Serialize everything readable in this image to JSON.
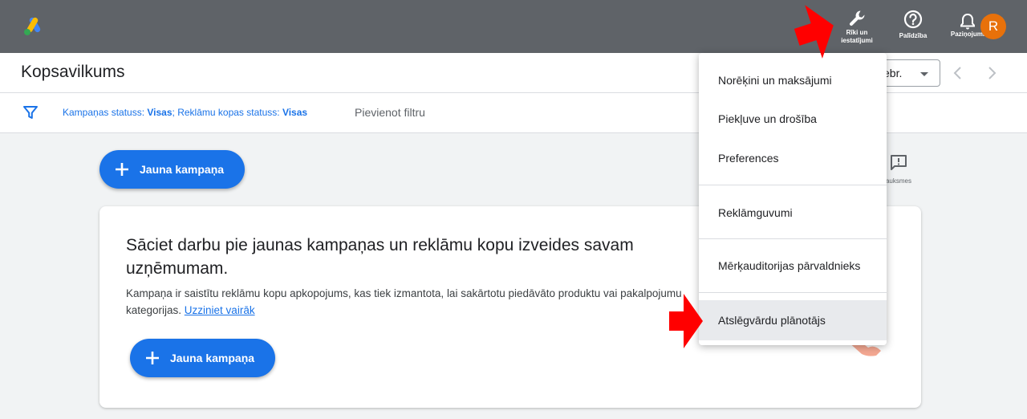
{
  "topbar": {
    "tools_label_line1": "Rīki un",
    "tools_label_line2": "iestatījumi",
    "help_label": "Palīdzība",
    "notifications_label": "Paziņojumi",
    "avatar_initial": "R",
    "bg_color": "#5f6368",
    "avatar_color": "#e8710a"
  },
  "header": {
    "page_title": "Kopsavilkums",
    "date_range_value": "ebr."
  },
  "filter_bar": {
    "campaign_status_label": "Kampaņas statuss: ",
    "campaign_status_value": "Visas",
    "ad_group_status_label": "; Reklāmu kopas statuss: ",
    "ad_group_status_value": "Visas",
    "add_filter": "Pievienot filtru"
  },
  "main": {
    "new_campaign_button": "Jauna kampaņa",
    "feedback_label": "auksmes"
  },
  "card": {
    "heading": "Sāciet darbu pie jaunas kampaņas un reklāmu kopu izveides savam uzņēmumam.",
    "body": "Kampaņa ir saistītu reklāmu kopu apkopojums, kas tiek izmantota, lai sakārtotu piedāvāto produktu vai pakalpojumu kategorijas. ",
    "learn_more": "Uzziniet vairāk",
    "button": "Jauna kampaņa"
  },
  "tools_menu": {
    "items": [
      {
        "label": "Norēķini un maksājumi"
      },
      {
        "label": "Piekļuve un drošība"
      },
      {
        "label": "Preferences"
      },
      {
        "label": "Reklāmguvumi"
      },
      {
        "label": "Mērķauditorijas pārvaldnieks"
      },
      {
        "label": "Atslēgvārdu plānotājs"
      }
    ]
  },
  "colors": {
    "accent": "#1a73e8",
    "annotation_arrow": "#ff0000"
  },
  "icons": [
    "google-ads-logo-icon",
    "wrench-icon",
    "help-circle-icon",
    "bell-icon",
    "filter-icon",
    "plus-icon",
    "feedback-icon",
    "chevron-left-icon",
    "chevron-right-icon"
  ]
}
